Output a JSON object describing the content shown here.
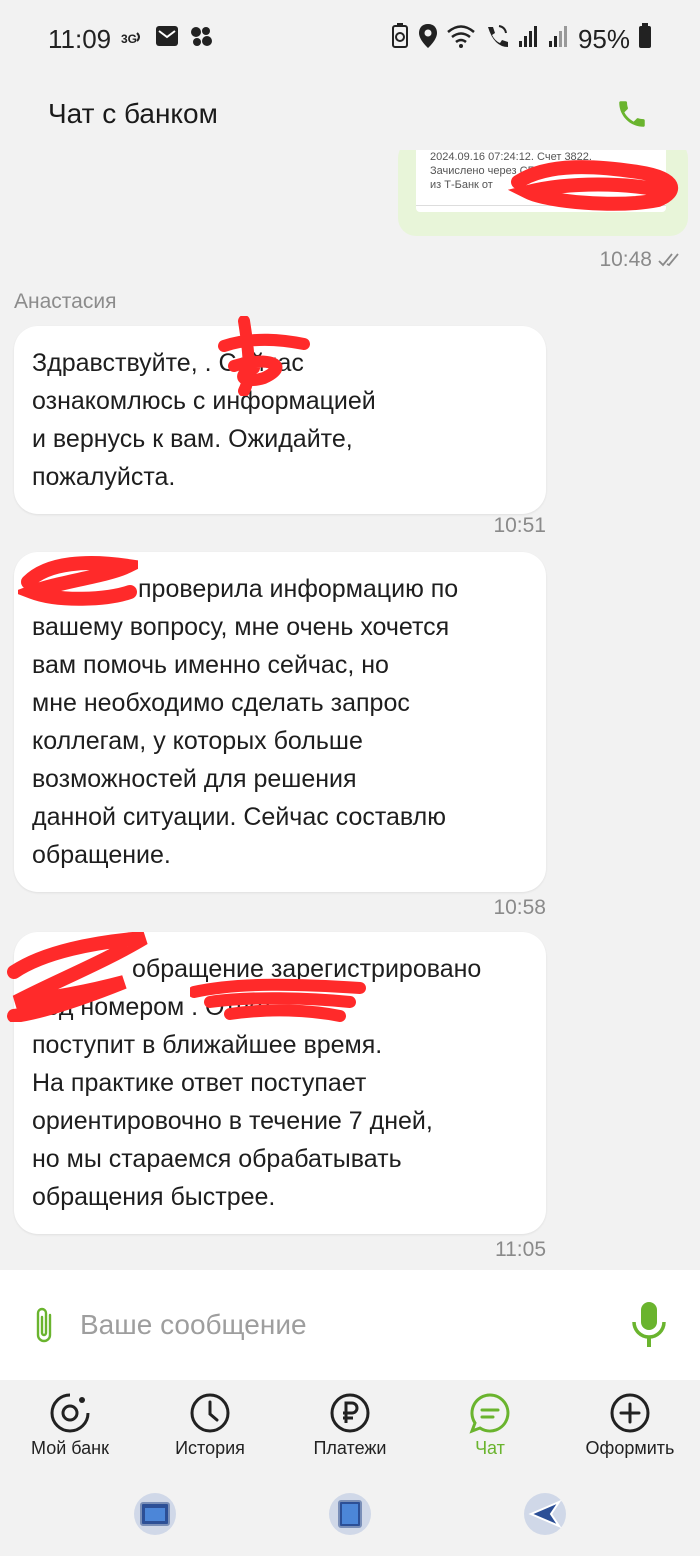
{
  "status_bar": {
    "time": "11:09",
    "battery": "95%"
  },
  "header": {
    "title": "Чат с банком"
  },
  "image_message": {
    "line1": "2024.09.16 07:24:12. Счет 3822.",
    "line2": "Зачислено через СБП 15000.00RUB",
    "line3": "из Т-Банк от",
    "time": "10:48"
  },
  "agent": {
    "name": "Анастасия"
  },
  "messages": [
    {
      "lines": [
        "Здравствуйте, . Сейчас",
        "ознакомлюсь с информацией",
        "и вернусь к вам. Ожидайте,",
        "пожалуйста."
      ],
      "time": "10:51"
    },
    {
      "lines": [
        "проверила информацию по",
        "вашему вопросу, мне очень хочется",
        "вам помочь именно сейчас, но",
        "мне необходимо сделать запрос",
        "коллегам, у которых больше",
        "возможностей для решения",
        "данной ситуации. Сейчас составлю",
        "обращение."
      ],
      "time": "10:58"
    },
    {
      "lines": [
        "обращение зарегистрировано",
        "под номером . Ответ",
        "поступит в ближайшее время.",
        "На практике ответ поступает",
        "ориентировочно в течение 7 дней,",
        "но мы стараемся обрабатывать",
        "обращения быстрее."
      ],
      "time": "11:05"
    }
  ],
  "input": {
    "placeholder": "Ваше сообщение"
  },
  "nav": {
    "items": [
      {
        "label": "Мой банк",
        "icon": "target-icon"
      },
      {
        "label": "История",
        "icon": "clock-icon"
      },
      {
        "label": "Платежи",
        "icon": "ruble-icon"
      },
      {
        "label": "Чат",
        "icon": "chat-icon"
      },
      {
        "label": "Оформить",
        "icon": "plus-icon"
      }
    ],
    "active": "Чат"
  },
  "colors": {
    "accent": "#6ab42e",
    "redaction": "#ff2a2a",
    "bubble_out": "#e8f5d9",
    "bubble_in": "#ffffff",
    "background": "#f2f2f2"
  }
}
